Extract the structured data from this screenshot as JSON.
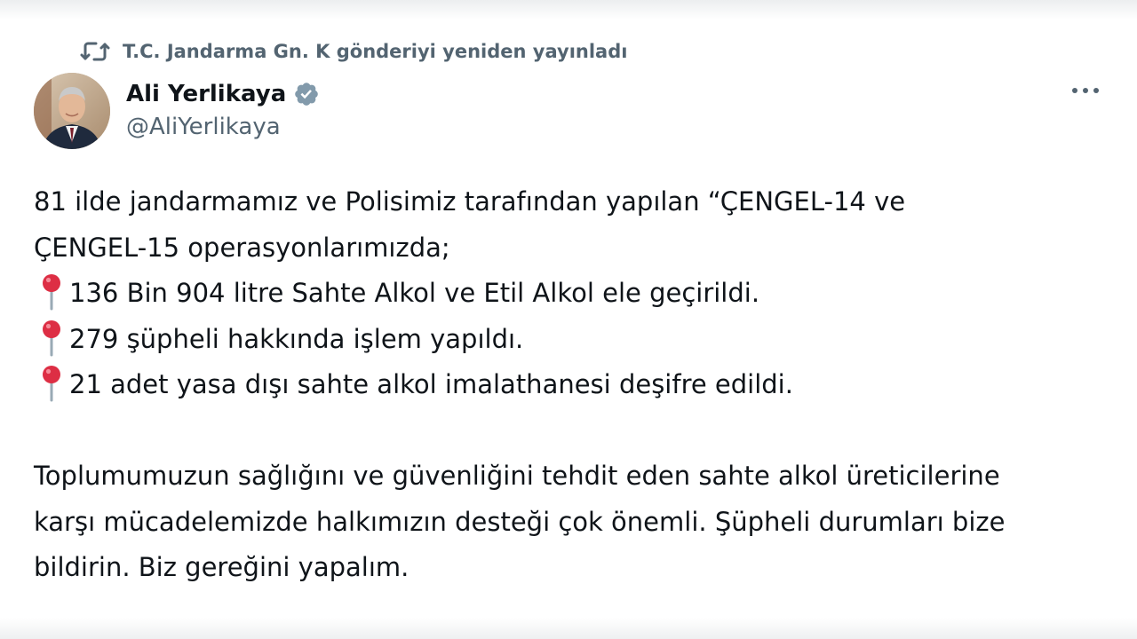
{
  "repost": {
    "icon": "repost-icon",
    "text": "T.C. Jandarma Gn. K gönderiyi yeniden yayınladı"
  },
  "author": {
    "display_name": "Ali Yerlikaya",
    "handle": "@AliYerlikaya",
    "verified_icon": "verified-badge-icon",
    "avatar": "avatar"
  },
  "menu": {
    "icon": "more-options-icon"
  },
  "post": {
    "intro_line_1": "81 ilde jandarmamız ve Polisimiz tarafından yapılan “ÇENGEL-14 ve",
    "intro_line_2": "ÇENGEL-15 operasyonlarımızda;",
    "bullet_icon": "round-pushpin-icon",
    "bullets": [
      "136 Bin 904 litre Sahte Alkol ve Etil Alkol ele geçirildi.",
      "279 şüpheli hakkında işlem yapıldı.",
      "21 adet yasa dışı sahte alkol imalathanesi deşifre edildi."
    ],
    "closing_line_1": "Toplumumuzun sağlığını ve güvenliğini tehdit eden sahte alkol üreticilerine",
    "closing_line_2": "karşı mücadelemizde halkımızın desteği çok önemli. Şüpheli durumları bize",
    "closing_line_3": "bildirin. Biz gereğini yapalım."
  },
  "colors": {
    "text_primary": "#0f1419",
    "text_secondary": "#536471",
    "verified_badge": "#829aab",
    "pin_red": "#dd2e44"
  }
}
